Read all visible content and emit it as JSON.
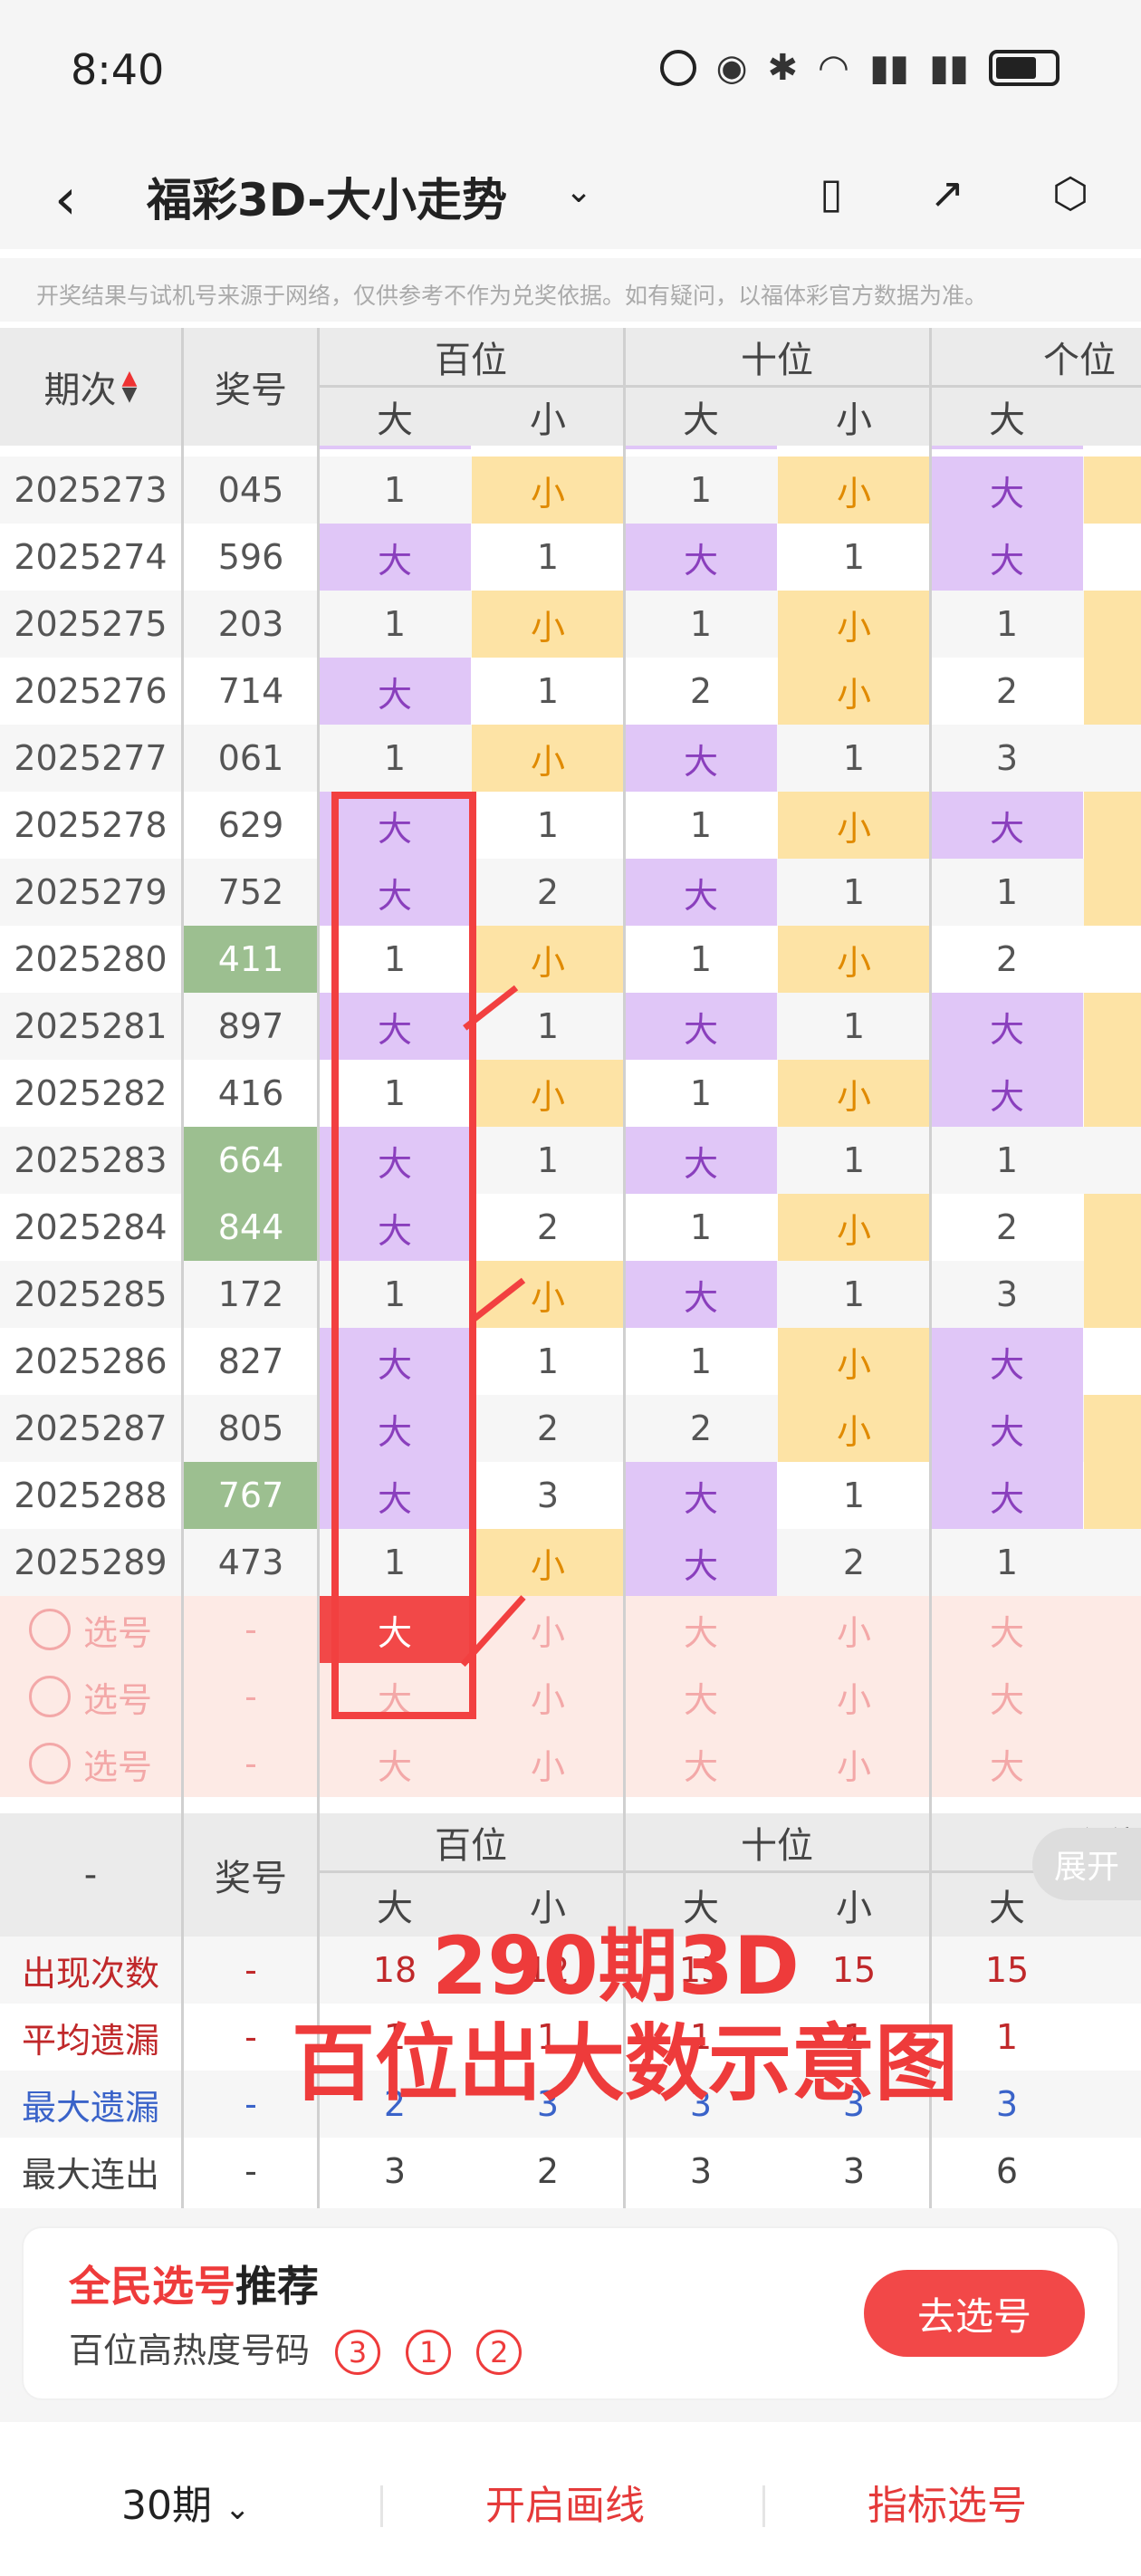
{
  "status": {
    "time": "8:40"
  },
  "title": {
    "text": "福彩3D-大小走势"
  },
  "notice": "开奖结果与试机号来源于网络，仅供参考不作为兑奖依据。如有疑问，以福体彩官方数据为准。",
  "header": {
    "period": "期次",
    "number": "奖号",
    "groups": [
      "百位",
      "十位",
      "个位"
    ],
    "subs": [
      "大",
      "小",
      "大",
      "小",
      "大"
    ]
  },
  "rows": [
    {
      "p": "2025273",
      "n": "045",
      "win": false,
      "c": [
        "1",
        "小",
        "1",
        "小",
        "大"
      ]
    },
    {
      "p": "2025274",
      "n": "596",
      "win": false,
      "c": [
        "大",
        "1",
        "大",
        "1",
        "大"
      ]
    },
    {
      "p": "2025275",
      "n": "203",
      "win": false,
      "c": [
        "1",
        "小",
        "1",
        "小",
        "1"
      ]
    },
    {
      "p": "2025276",
      "n": "714",
      "win": false,
      "c": [
        "大",
        "1",
        "2",
        "小",
        "2"
      ]
    },
    {
      "p": "2025277",
      "n": "061",
      "win": false,
      "c": [
        "1",
        "小",
        "大",
        "1",
        "3"
      ]
    },
    {
      "p": "2025278",
      "n": "629",
      "win": false,
      "c": [
        "大",
        "1",
        "1",
        "小",
        "大"
      ]
    },
    {
      "p": "2025279",
      "n": "752",
      "win": false,
      "c": [
        "大",
        "2",
        "大",
        "1",
        "1"
      ]
    },
    {
      "p": "2025280",
      "n": "411",
      "win": true,
      "c": [
        "1",
        "小",
        "1",
        "小",
        "2"
      ]
    },
    {
      "p": "2025281",
      "n": "897",
      "win": false,
      "c": [
        "大",
        "1",
        "大",
        "1",
        "大"
      ]
    },
    {
      "p": "2025282",
      "n": "416",
      "win": false,
      "c": [
        "1",
        "小",
        "1",
        "小",
        "大"
      ]
    },
    {
      "p": "2025283",
      "n": "664",
      "win": true,
      "c": [
        "大",
        "1",
        "大",
        "1",
        "1"
      ]
    },
    {
      "p": "2025284",
      "n": "844",
      "win": true,
      "c": [
        "大",
        "2",
        "1",
        "小",
        "2"
      ]
    },
    {
      "p": "2025285",
      "n": "172",
      "win": false,
      "c": [
        "1",
        "小",
        "大",
        "1",
        "3"
      ]
    },
    {
      "p": "2025286",
      "n": "827",
      "win": false,
      "c": [
        "大",
        "1",
        "1",
        "小",
        "大"
      ]
    },
    {
      "p": "2025287",
      "n": "805",
      "win": false,
      "c": [
        "大",
        "2",
        "2",
        "小",
        "大"
      ]
    },
    {
      "p": "2025288",
      "n": "767",
      "win": true,
      "c": [
        "大",
        "3",
        "大",
        "1",
        "大"
      ]
    },
    {
      "p": "2025289",
      "n": "473",
      "win": false,
      "c": [
        "1",
        "小",
        "大",
        "2",
        "1"
      ]
    }
  ],
  "picks": [
    {
      "label": "选号",
      "n": "-",
      "c": [
        "大",
        "小",
        "大",
        "小",
        "大"
      ]
    },
    {
      "label": "选号",
      "n": "-",
      "c": [
        "大",
        "小",
        "大",
        "小",
        "大"
      ]
    },
    {
      "label": "选号",
      "n": "-",
      "c": [
        "大",
        "小",
        "大",
        "小",
        "大"
      ]
    }
  ],
  "footer_header": {
    "dash": "-",
    "number": "奖号",
    "groups": [
      "百位",
      "十位",
      "个位"
    ],
    "subs": [
      "大",
      "小",
      "大",
      "小",
      "大"
    ]
  },
  "stats": [
    {
      "label": "出现次数",
      "color": "#c0282a",
      "n": "-",
      "c": [
        "18",
        "12",
        "15",
        "15",
        "15"
      ]
    },
    {
      "label": "平均遗漏",
      "color": "#c0282a",
      "n": "-",
      "c": [
        "1",
        "1",
        "1",
        "1",
        "1"
      ]
    },
    {
      "label": "最大遗漏",
      "color": "#3a63c9",
      "n": "-",
      "c": [
        "2",
        "3",
        "3",
        "3",
        "3"
      ]
    },
    {
      "label": "最大连出",
      "color": "#444444",
      "n": "-",
      "c": [
        "3",
        "2",
        "3",
        "3",
        "6"
      ]
    }
  ],
  "annotation": {
    "line1": "290期3D",
    "line2": "百位出大数示意图"
  },
  "highlight_pick": "大",
  "expand_label": "展开",
  "recommend": {
    "title_red": "全民选号",
    "title_black": "推荐",
    "sub": "百位高热度号码",
    "balls": [
      "3",
      "1",
      "2"
    ],
    "button": "去选号"
  },
  "bottom": {
    "periods": "30期",
    "draw": "开启画线",
    "indicator": "指标选号"
  }
}
